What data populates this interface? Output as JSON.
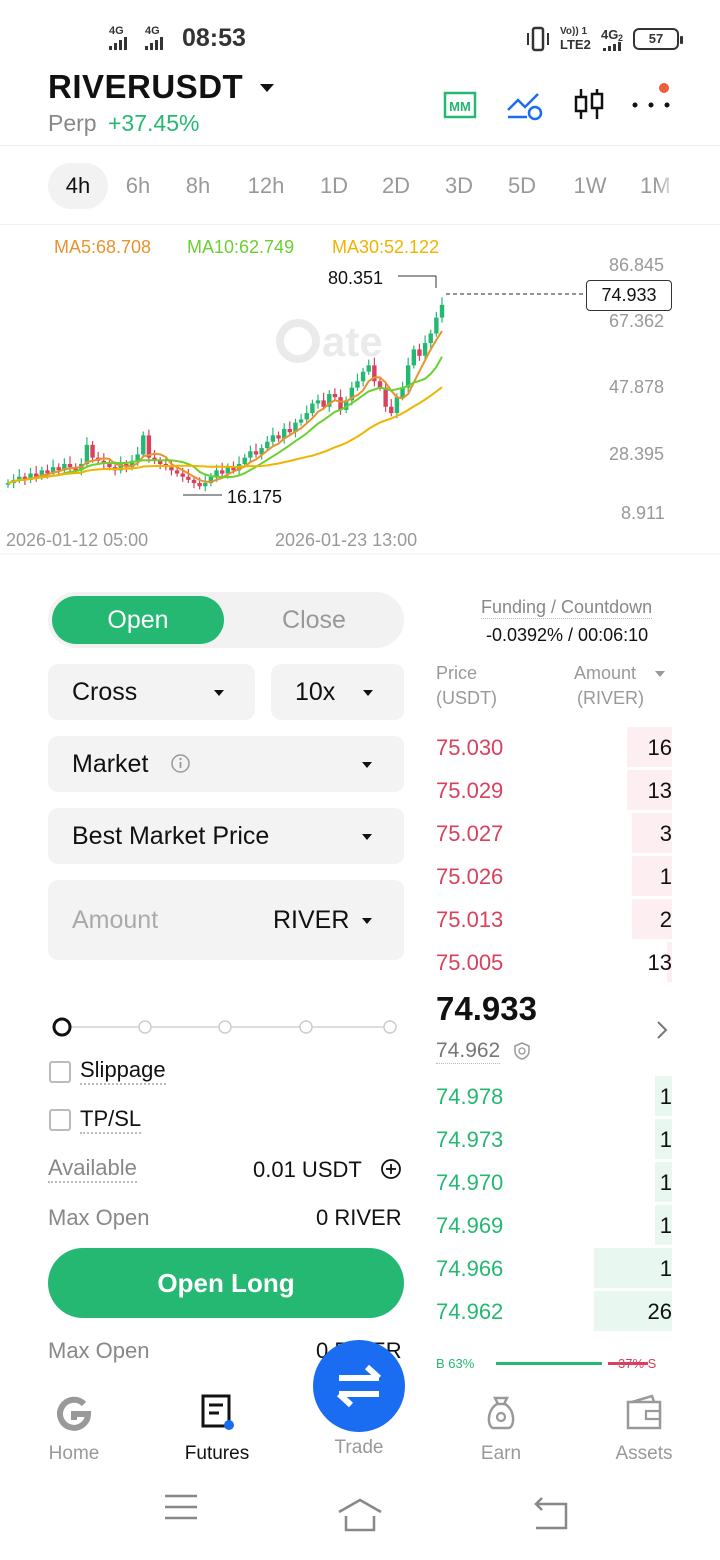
{
  "status_bar": {
    "sim1": "4G",
    "sim2": "4G",
    "time": "08:53",
    "volte": "Vo)) 1",
    "lte": "LTE2",
    "net2": "4G",
    "net2_sub": "2",
    "battery": "57"
  },
  "header": {
    "pair": "RIVERUSDT",
    "type": "Perp",
    "change": "+37.45%",
    "icons": [
      "mm-icon",
      "trend-settings-icon",
      "candlestick-icon",
      "more-icon"
    ],
    "accent": "#25b873"
  },
  "tabs": [
    {
      "label": "4h",
      "active": true
    },
    {
      "label": "6h"
    },
    {
      "label": "8h"
    },
    {
      "label": "12h"
    },
    {
      "label": "1D"
    },
    {
      "label": "2D"
    },
    {
      "label": "3D"
    },
    {
      "label": "5D"
    },
    {
      "label": "1W"
    },
    {
      "label": "1M"
    }
  ],
  "chart": {
    "ma5": "MA5:68.708",
    "ma10": "MA10:62.749",
    "ma30": "MA30:52.122",
    "high_label": "80.351",
    "low_label": "16.175",
    "last_price": "74.933",
    "y_ticks": [
      "86.845",
      "67.362",
      "47.878",
      "28.395",
      "8.911"
    ],
    "x_ticks": [
      "2026-01-12 05:00",
      "2026-01-23 13:00"
    ],
    "colors": {
      "ma5": "#e8932e",
      "ma10": "#6bd12f",
      "ma30": "#f0b400",
      "up": "#25b873",
      "down": "#d9415e"
    }
  },
  "chart_data": {
    "type": "candlestick",
    "y_axis_ticks": [
      86.845,
      67.362,
      47.878,
      28.395,
      8.911
    ],
    "x_axis_ticks": [
      "2026-01-12 05:00",
      "2026-01-23 13:00"
    ],
    "ylim": [
      8.911,
      86.845
    ],
    "high": 80.351,
    "low": 16.175,
    "last": 74.933,
    "close_series": [
      18,
      19,
      20,
      19,
      21,
      20,
      22,
      21,
      23,
      22,
      24,
      23,
      22,
      24,
      30,
      26,
      25,
      24,
      23,
      22,
      24,
      23,
      25,
      27,
      33,
      26,
      25,
      24,
      23,
      22,
      21,
      20,
      19,
      18,
      17,
      18,
      20,
      22,
      21,
      23,
      22,
      24,
      26,
      28,
      27,
      29,
      31,
      33,
      32,
      35,
      34,
      37,
      38,
      40,
      43,
      44,
      42,
      46,
      45,
      41,
      44,
      48,
      50,
      53,
      55,
      50,
      48,
      42,
      40,
      45,
      48,
      55,
      60,
      58,
      62,
      65,
      70,
      74
    ]
  },
  "form": {
    "open_label": "Open",
    "close_label": "Close",
    "margin_mode": "Cross",
    "leverage": "10x",
    "order_type": "Market",
    "price_mode": "Best Market Price",
    "amount_placeholder": "Amount",
    "amount_unit": "RIVER",
    "slider_level": 0,
    "slippage_label": "Slippage",
    "tpsl_label": "TP/SL",
    "available_label": "Available",
    "available_value": "0.01 USDT",
    "max_open_label": "Max Open",
    "max_open_value": "0 RIVER",
    "open_long_label": "Open Long",
    "max_open_label2": "Max Open",
    "max_open_value2": "0 RIVER"
  },
  "orderbook": {
    "funding_label": "Funding / Countdown",
    "funding_value": "-0.0392% / 00:06:10",
    "price_header": "Price",
    "price_unit": "(USDT)",
    "amount_header": "Amount",
    "amount_unit": "(RIVER)",
    "asks": [
      {
        "price": "75.030",
        "amount": "16",
        "depth": 0.19
      },
      {
        "price": "75.029",
        "amount": "13",
        "depth": 0.19
      },
      {
        "price": "75.027",
        "amount": "3",
        "depth": 0.17
      },
      {
        "price": "75.026",
        "amount": "1",
        "depth": 0.17
      },
      {
        "price": "75.013",
        "amount": "2",
        "depth": 0.17
      },
      {
        "price": "75.005",
        "amount": "13",
        "depth": 0.02
      }
    ],
    "last_price": "74.933",
    "mark_price": "74.962",
    "bids": [
      {
        "price": "74.978",
        "amount": "1",
        "depth": 0.07
      },
      {
        "price": "74.973",
        "amount": "1",
        "depth": 0.07
      },
      {
        "price": "74.970",
        "amount": "1",
        "depth": 0.07
      },
      {
        "price": "74.969",
        "amount": "1",
        "depth": 0.07
      },
      {
        "price": "74.966",
        "amount": "1",
        "depth": 0.33
      },
      {
        "price": "74.962",
        "amount": "26",
        "depth": 0.33
      }
    ],
    "ratio_left": "B 63%",
    "ratio_right": "37% S",
    "ask_color": "#d9415e",
    "bid_color": "#25b873"
  },
  "bottom_nav": [
    {
      "label": "Home"
    },
    {
      "label": "Futures",
      "active": true
    },
    {
      "label": "Trade"
    },
    {
      "label": "Earn"
    },
    {
      "label": "Assets"
    }
  ]
}
